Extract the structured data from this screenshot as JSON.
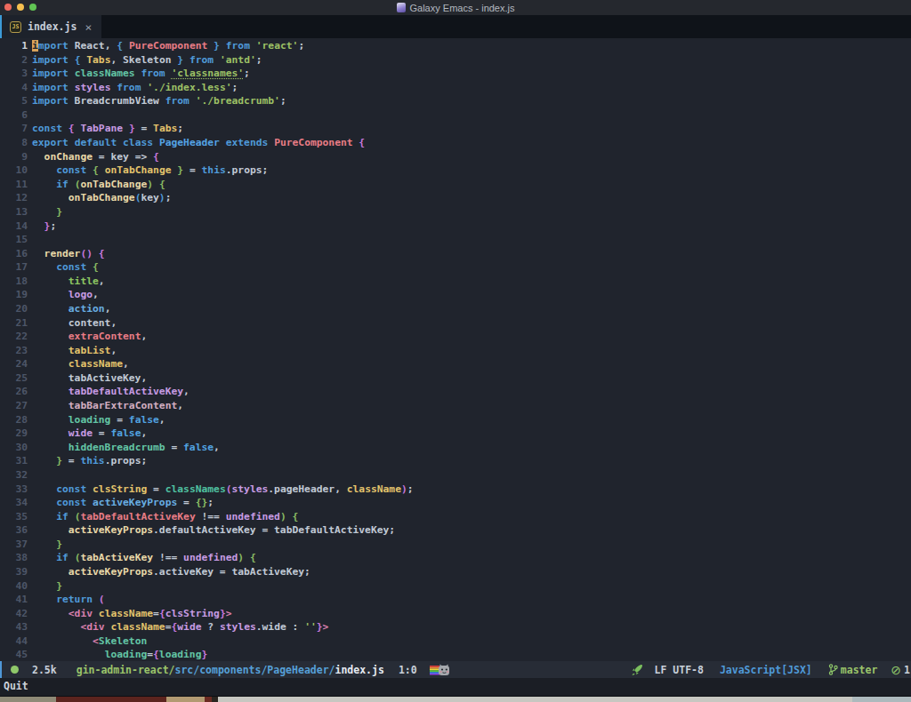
{
  "window": {
    "title": "Galaxy Emacs - index.js"
  },
  "tab": {
    "icon": "JS",
    "label": "index.js",
    "close": "×"
  },
  "editor": {
    "lines": [
      {
        "n": "1",
        "t": [
          [
            "i",
            "cursor"
          ],
          [
            "mport",
            "k"
          ],
          [
            " React, ",
            "d"
          ],
          [
            "{",
            "r3"
          ],
          [
            " ",
            "d"
          ],
          [
            "PureComponent",
            "t"
          ],
          [
            " ",
            "d"
          ],
          [
            "}",
            "r3"
          ],
          [
            " ",
            "d"
          ],
          [
            "from",
            "k"
          ],
          [
            " ",
            "d"
          ],
          [
            "'react'",
            "s"
          ],
          [
            ";",
            "d"
          ]
        ]
      },
      {
        "n": "2",
        "t": [
          [
            "import",
            "k"
          ],
          [
            " ",
            "d"
          ],
          [
            "{",
            "r3"
          ],
          [
            " ",
            "d"
          ],
          [
            "Tabs",
            "g"
          ],
          [
            ", Skeleton ",
            "d"
          ],
          [
            "}",
            "r3"
          ],
          [
            " ",
            "d"
          ],
          [
            "from",
            "k"
          ],
          [
            " ",
            "d"
          ],
          [
            "'antd'",
            "s"
          ],
          [
            ";",
            "d"
          ]
        ]
      },
      {
        "n": "3",
        "t": [
          [
            "import",
            "k"
          ],
          [
            " ",
            "d"
          ],
          [
            "classNames",
            "m"
          ],
          [
            " ",
            "d"
          ],
          [
            "from",
            "k"
          ],
          [
            " ",
            "d"
          ],
          [
            "'classnames'",
            "su"
          ],
          [
            ";",
            "d"
          ]
        ]
      },
      {
        "n": "4",
        "t": [
          [
            "import",
            "k"
          ],
          [
            " ",
            "d"
          ],
          [
            "styles",
            "v"
          ],
          [
            " ",
            "d"
          ],
          [
            "from",
            "k"
          ],
          [
            " ",
            "d"
          ],
          [
            "'./index.less'",
            "s"
          ],
          [
            ";",
            "d"
          ]
        ]
      },
      {
        "n": "5",
        "t": [
          [
            "import",
            "k"
          ],
          [
            " BreadcrumbView ",
            "d"
          ],
          [
            "from",
            "k"
          ],
          [
            " ",
            "d"
          ],
          [
            "'./breadcrumb'",
            "s"
          ],
          [
            ";",
            "d"
          ]
        ]
      },
      {
        "n": "6",
        "t": []
      },
      {
        "n": "7",
        "t": [
          [
            "const",
            "k"
          ],
          [
            " ",
            "d"
          ],
          [
            "{",
            "r1"
          ],
          [
            " ",
            "d"
          ],
          [
            "TabPane",
            "v"
          ],
          [
            " ",
            "d"
          ],
          [
            "}",
            "r1"
          ],
          [
            " = ",
            "d"
          ],
          [
            "Tabs",
            "g"
          ],
          [
            ";",
            "d"
          ]
        ]
      },
      {
        "n": "8",
        "t": [
          [
            "export",
            "k"
          ],
          [
            " ",
            "d"
          ],
          [
            "default",
            "k"
          ],
          [
            " ",
            "d"
          ],
          [
            "class",
            "k"
          ],
          [
            " ",
            "d"
          ],
          [
            "PageHeader",
            "fb"
          ],
          [
            " ",
            "d"
          ],
          [
            "extends",
            "k"
          ],
          [
            " ",
            "d"
          ],
          [
            "PureComponent",
            "t"
          ],
          [
            " ",
            "d"
          ],
          [
            "{",
            "r1"
          ]
        ]
      },
      {
        "n": "9",
        "t": [
          [
            "  ",
            "d"
          ],
          [
            "onChange",
            "c"
          ],
          [
            " = key => ",
            "d"
          ],
          [
            "{",
            "r1"
          ]
        ]
      },
      {
        "n": "10",
        "t": [
          [
            "    ",
            "d"
          ],
          [
            "const",
            "k"
          ],
          [
            " ",
            "d"
          ],
          [
            "{",
            "r2"
          ],
          [
            " ",
            "d"
          ],
          [
            "onTabChange",
            "g"
          ],
          [
            " ",
            "d"
          ],
          [
            "}",
            "r2"
          ],
          [
            " = ",
            "d"
          ],
          [
            "this",
            "k"
          ],
          [
            ".props;",
            "d"
          ]
        ]
      },
      {
        "n": "11",
        "t": [
          [
            "    ",
            "d"
          ],
          [
            "if",
            "k"
          ],
          [
            " ",
            "d"
          ],
          [
            "(",
            "r2"
          ],
          [
            "onTabChange",
            "c"
          ],
          [
            ")",
            "r2"
          ],
          [
            " ",
            "d"
          ],
          [
            "{",
            "r2"
          ]
        ]
      },
      {
        "n": "12",
        "t": [
          [
            "      ",
            "d"
          ],
          [
            "onTabChange",
            "c"
          ],
          [
            "(",
            "r3"
          ],
          [
            "key",
            "d"
          ],
          [
            ")",
            "r3"
          ],
          [
            ";",
            "d"
          ]
        ]
      },
      {
        "n": "13",
        "t": [
          [
            "    ",
            "d"
          ],
          [
            "}",
            "r2"
          ]
        ]
      },
      {
        "n": "14",
        "t": [
          [
            "  ",
            "d"
          ],
          [
            "}",
            "r1"
          ],
          [
            ";",
            "d"
          ]
        ]
      },
      {
        "n": "15",
        "t": []
      },
      {
        "n": "16",
        "t": [
          [
            "  ",
            "d"
          ],
          [
            "render",
            "c"
          ],
          [
            "()",
            "r1"
          ],
          [
            " ",
            "d"
          ],
          [
            "{",
            "r1"
          ]
        ]
      },
      {
        "n": "17",
        "t": [
          [
            "    ",
            "d"
          ],
          [
            "const",
            "k"
          ],
          [
            " ",
            "d"
          ],
          [
            "{",
            "r2"
          ]
        ]
      },
      {
        "n": "18",
        "t": [
          [
            "      ",
            "d"
          ],
          [
            "title",
            "grn"
          ],
          [
            ",",
            "d"
          ]
        ]
      },
      {
        "n": "19",
        "t": [
          [
            "      ",
            "d"
          ],
          [
            "logo",
            "v"
          ],
          [
            ",",
            "d"
          ]
        ]
      },
      {
        "n": "20",
        "t": [
          [
            "      ",
            "d"
          ],
          [
            "action",
            "bl"
          ],
          [
            ",",
            "d"
          ]
        ]
      },
      {
        "n": "21",
        "t": [
          [
            "      content,",
            "d"
          ]
        ]
      },
      {
        "n": "22",
        "t": [
          [
            "      ",
            "d"
          ],
          [
            "extraContent",
            "t"
          ],
          [
            ",",
            "d"
          ]
        ]
      },
      {
        "n": "23",
        "t": [
          [
            "      ",
            "d"
          ],
          [
            "tabList",
            "g"
          ],
          [
            ",",
            "d"
          ]
        ]
      },
      {
        "n": "24",
        "t": [
          [
            "      ",
            "d"
          ],
          [
            "className",
            "g"
          ],
          [
            ",",
            "d"
          ]
        ]
      },
      {
        "n": "25",
        "t": [
          [
            "      tabActiveKey,",
            "d"
          ]
        ]
      },
      {
        "n": "26",
        "t": [
          [
            "      ",
            "d"
          ],
          [
            "tabDefaultActiveKey",
            "v"
          ],
          [
            ",",
            "d"
          ]
        ]
      },
      {
        "n": "27",
        "t": [
          [
            "      ",
            "d"
          ],
          [
            "tabBarExtraContent",
            "pk"
          ],
          [
            ",",
            "d"
          ]
        ]
      },
      {
        "n": "28",
        "t": [
          [
            "      ",
            "d"
          ],
          [
            "loading",
            "m"
          ],
          [
            " = ",
            "d"
          ],
          [
            "false",
            "fa"
          ],
          [
            ",",
            "d"
          ]
        ]
      },
      {
        "n": "29",
        "t": [
          [
            "      ",
            "d"
          ],
          [
            "wide",
            "v"
          ],
          [
            " = ",
            "d"
          ],
          [
            "false",
            "fa"
          ],
          [
            ",",
            "d"
          ]
        ]
      },
      {
        "n": "30",
        "t": [
          [
            "      ",
            "d"
          ],
          [
            "hiddenBreadcrumb",
            "m"
          ],
          [
            " = ",
            "d"
          ],
          [
            "false",
            "fa"
          ],
          [
            ",",
            "d"
          ]
        ]
      },
      {
        "n": "31",
        "t": [
          [
            "    ",
            "d"
          ],
          [
            "}",
            "r2"
          ],
          [
            " = ",
            "d"
          ],
          [
            "this",
            "k"
          ],
          [
            ".props;",
            "d"
          ]
        ]
      },
      {
        "n": "32",
        "t": []
      },
      {
        "n": "33",
        "t": [
          [
            "    ",
            "d"
          ],
          [
            "const",
            "k"
          ],
          [
            " ",
            "d"
          ],
          [
            "clsString",
            "g"
          ],
          [
            " = ",
            "d"
          ],
          [
            "classNames",
            "mb"
          ],
          [
            "(",
            "r1"
          ],
          [
            "styles",
            "v"
          ],
          [
            ".pageHeader, ",
            "d"
          ],
          [
            "className",
            "g"
          ],
          [
            ")",
            "r1"
          ],
          [
            ";",
            "d"
          ]
        ]
      },
      {
        "n": "34",
        "t": [
          [
            "    ",
            "d"
          ],
          [
            "const",
            "k"
          ],
          [
            " ",
            "d"
          ],
          [
            "activeKeyProps",
            "bl"
          ],
          [
            " = ",
            "d"
          ],
          [
            "{}",
            "r2"
          ],
          [
            ";",
            "d"
          ]
        ]
      },
      {
        "n": "35",
        "t": [
          [
            "    ",
            "d"
          ],
          [
            "if",
            "k"
          ],
          [
            " ",
            "d"
          ],
          [
            "(",
            "r2"
          ],
          [
            "tabDefaultActiveKey",
            "t"
          ],
          [
            " !== ",
            "d"
          ],
          [
            "undefined",
            "v"
          ],
          [
            ")",
            "r2"
          ],
          [
            " ",
            "d"
          ],
          [
            "{",
            "r2"
          ]
        ]
      },
      {
        "n": "36",
        "t": [
          [
            "      ",
            "d"
          ],
          [
            "activeKeyProps",
            "c"
          ],
          [
            ".defaultActiveKey = tabDefaultActiveKey;",
            "d"
          ]
        ]
      },
      {
        "n": "37",
        "t": [
          [
            "    ",
            "d"
          ],
          [
            "}",
            "r2"
          ]
        ]
      },
      {
        "n": "38",
        "t": [
          [
            "    ",
            "d"
          ],
          [
            "if",
            "k"
          ],
          [
            " ",
            "d"
          ],
          [
            "(",
            "r2"
          ],
          [
            "tabActiveKey",
            "c"
          ],
          [
            " !== ",
            "d"
          ],
          [
            "undefined",
            "v"
          ],
          [
            ")",
            "r2"
          ],
          [
            " ",
            "d"
          ],
          [
            "{",
            "r2"
          ]
        ]
      },
      {
        "n": "39",
        "t": [
          [
            "      ",
            "d"
          ],
          [
            "activeKeyProps",
            "c"
          ],
          [
            ".activeKey = tabActiveKey;",
            "d"
          ]
        ]
      },
      {
        "n": "40",
        "t": [
          [
            "    ",
            "d"
          ],
          [
            "}",
            "r2"
          ]
        ]
      },
      {
        "n": "41",
        "t": [
          [
            "    ",
            "d"
          ],
          [
            "return",
            "k"
          ],
          [
            " ",
            "d"
          ],
          [
            "(",
            "r1"
          ]
        ]
      },
      {
        "n": "42",
        "t": [
          [
            "      ",
            "d"
          ],
          [
            "<div",
            "p"
          ],
          [
            " ",
            "d"
          ],
          [
            "className",
            "g"
          ],
          [
            "=",
            "d"
          ],
          [
            "{",
            "r1"
          ],
          [
            "clsString",
            "v"
          ],
          [
            "}",
            "r1"
          ],
          [
            ">",
            "p"
          ]
        ]
      },
      {
        "n": "43",
        "t": [
          [
            "        ",
            "d"
          ],
          [
            "<div",
            "p"
          ],
          [
            " ",
            "d"
          ],
          [
            "className",
            "g"
          ],
          [
            "=",
            "d"
          ],
          [
            "{",
            "r1"
          ],
          [
            "wide",
            "v"
          ],
          [
            " ? ",
            "d"
          ],
          [
            "styles",
            "v"
          ],
          [
            ".wide : ",
            "d"
          ],
          [
            "''",
            "s"
          ],
          [
            "}",
            "r1"
          ],
          [
            ">",
            "p"
          ]
        ]
      },
      {
        "n": "44",
        "t": [
          [
            "          ",
            "d"
          ],
          [
            "<",
            "p"
          ],
          [
            "Skeleton",
            "m"
          ]
        ]
      },
      {
        "n": "45",
        "t": [
          [
            "            ",
            "d"
          ],
          [
            "loading",
            "m"
          ],
          [
            "=",
            "d"
          ],
          [
            "{",
            "r1"
          ],
          [
            "loading",
            "m"
          ],
          [
            "}",
            "r1"
          ]
        ]
      }
    ]
  },
  "modeline": {
    "size": "2.5k",
    "path_dir1": "gin-admin-react/",
    "path_dir2": "src/components/PageHeader/",
    "file": "index.js",
    "position": "1:0",
    "eol_encoding": "LF UTF-8",
    "major_mode": "JavaScript[JSX]",
    "branch": "master",
    "issue_count": "1"
  },
  "echo": {
    "message": "Quit"
  }
}
